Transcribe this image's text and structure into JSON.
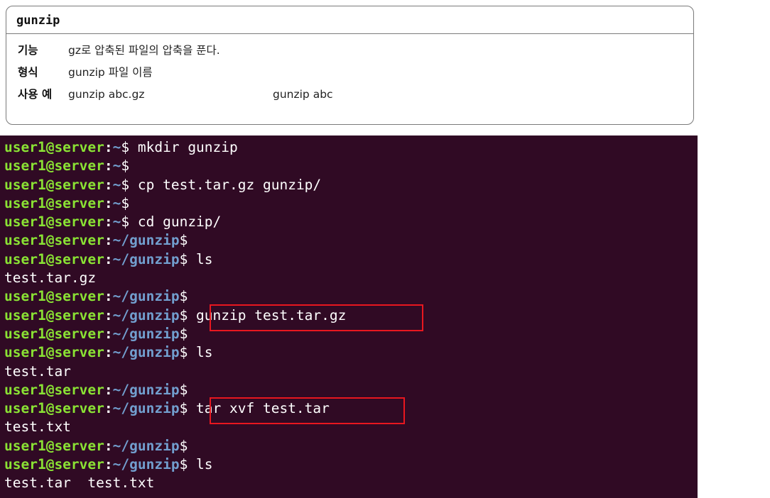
{
  "info_box": {
    "title": "gunzip",
    "rows": [
      {
        "label": "기능",
        "value": "gz로 압축된 파일의 압축을 푼다.",
        "value2": ""
      },
      {
        "label": "형식",
        "value": "gunzip 파일 이름",
        "value2": ""
      },
      {
        "label": "사용 예",
        "value": "gunzip abc.gz",
        "value2": "gunzip abc"
      }
    ]
  },
  "terminal": {
    "user_host": "user1@server",
    "colon": ":",
    "dollar": "$",
    "lines": [
      {
        "type": "prompt",
        "path": "~",
        "cmd": " mkdir gunzip"
      },
      {
        "type": "prompt",
        "path": "~",
        "cmd": ""
      },
      {
        "type": "prompt",
        "path": "~",
        "cmd": " cp test.tar.gz gunzip/"
      },
      {
        "type": "prompt",
        "path": "~",
        "cmd": ""
      },
      {
        "type": "prompt",
        "path": "~",
        "cmd": " cd gunzip/"
      },
      {
        "type": "prompt",
        "path": "~/gunzip",
        "cmd": ""
      },
      {
        "type": "prompt",
        "path": "~/gunzip",
        "cmd": " ls"
      },
      {
        "type": "output",
        "text": "test.tar.gz"
      },
      {
        "type": "prompt",
        "path": "~/gunzip",
        "cmd": ""
      },
      {
        "type": "prompt",
        "path": "~/gunzip",
        "cmd": " gunzip test.tar.gz"
      },
      {
        "type": "prompt",
        "path": "~/gunzip",
        "cmd": ""
      },
      {
        "type": "prompt",
        "path": "~/gunzip",
        "cmd": " ls"
      },
      {
        "type": "output",
        "text": "test.tar"
      },
      {
        "type": "prompt",
        "path": "~/gunzip",
        "cmd": ""
      },
      {
        "type": "prompt",
        "path": "~/gunzip",
        "cmd": " tar xvf test.tar"
      },
      {
        "type": "output",
        "text": "test.txt"
      },
      {
        "type": "prompt",
        "path": "~/gunzip",
        "cmd": ""
      },
      {
        "type": "prompt",
        "path": "~/gunzip",
        "cmd": " ls"
      },
      {
        "type": "output",
        "text": "test.tar  test.txt"
      }
    ]
  },
  "colors": {
    "terminal_bg": "#300a24",
    "user_green": "#8ae234",
    "path_blue": "#729fcf",
    "highlight_red": "#e8171f"
  }
}
